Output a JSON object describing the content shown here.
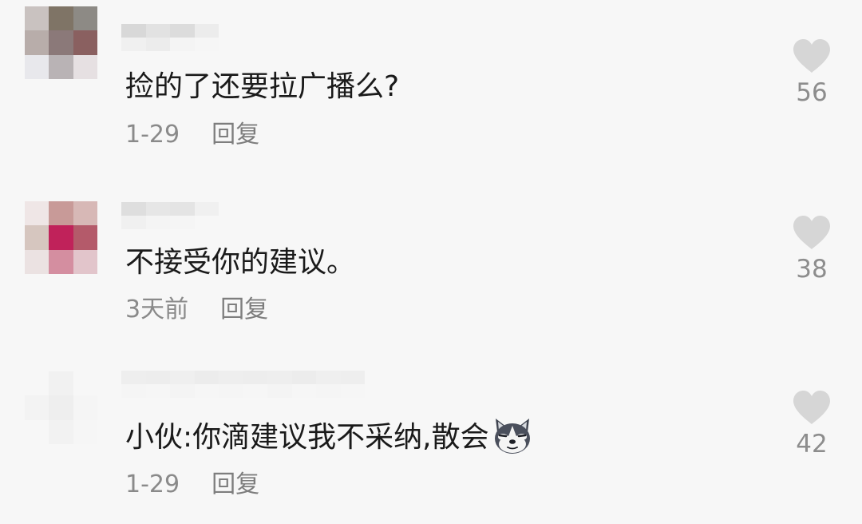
{
  "comments": [
    {
      "text": "捡的了还要拉广播么?",
      "time": "1-29",
      "reply_label": "回复",
      "likes": "56",
      "avatar_colors": [
        "#c9c2c0",
        "#7f7466",
        "#8d8a85",
        "#b8adaa",
        "#8b7979",
        "#8a6060",
        "#e8e8ec",
        "#b9b3b5",
        "#e6e0e2"
      ],
      "name_colors": [
        "#d8d8d8",
        "#e2e2e2",
        "#dcdcdc",
        "#ececec",
        "#f0f0f0",
        "#ececec",
        "#f4f4f4",
        "#f6f6f6"
      ]
    },
    {
      "text": "不接受你的建议。",
      "time": "3天前",
      "reply_label": "回复",
      "likes": "38",
      "avatar_colors": [
        "#efe6e6",
        "#c89a98",
        "#d7b8b6",
        "#d6c6bf",
        "#c0225a",
        "#b45a6a",
        "#ebe2e2",
        "#d48ea0",
        "#e2c5cb"
      ],
      "name_colors": [
        "#dedede",
        "#e6e6e6",
        "#e4e4e4",
        "#f0f0f0",
        "#f0f0f0",
        "#f4f4f4",
        "#f5f5f5",
        "#f7f7f7"
      ]
    },
    {
      "text": "小伙:你滴建议我不采纳,散会",
      "time": "1-29",
      "reply_label": "回复",
      "likes": "42",
      "avatar_colors": [
        "#f7f7f7",
        "#f1f1f1",
        "#f7f7f7",
        "#f3f3f3",
        "#eeeeee",
        "#f5f5f5",
        "#f7f7f7",
        "#f2f2f2",
        "#f6f6f6"
      ],
      "name_colors": [
        "#eeeeee",
        "#ededed",
        "#efefef",
        "#ececec",
        "#eeeeee",
        "#ededed",
        "#eeeeee",
        "#ececec",
        "#efefef",
        "#eeeeee",
        "#f5f5f5",
        "#f6f6f6",
        "#f4f4f4",
        "#f6f6f6",
        "#f5f5f5",
        "#f6f6f6",
        "#f4f4f4",
        "#f6f6f6",
        "#f5f5f5",
        "#f6f6f6"
      ],
      "emoji": "husky-dog-emoji"
    }
  ],
  "colors": {
    "like_icon": "#d6d6d6",
    "background": "#f7f7f7"
  }
}
